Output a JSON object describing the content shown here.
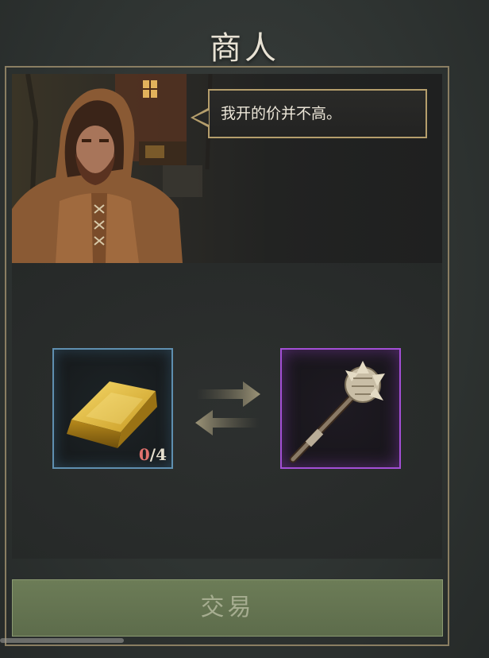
{
  "header": {
    "title": "商人"
  },
  "merchant": {
    "dialogue": "我开的价并不高。"
  },
  "trade": {
    "give_item": {
      "name": "gold-bar",
      "have": "0",
      "need": "/4",
      "border_color": "#5f8fb0"
    },
    "receive_item": {
      "name": "mace",
      "border_color": "#a34fd6"
    }
  },
  "actions": {
    "trade_label": "交易"
  }
}
